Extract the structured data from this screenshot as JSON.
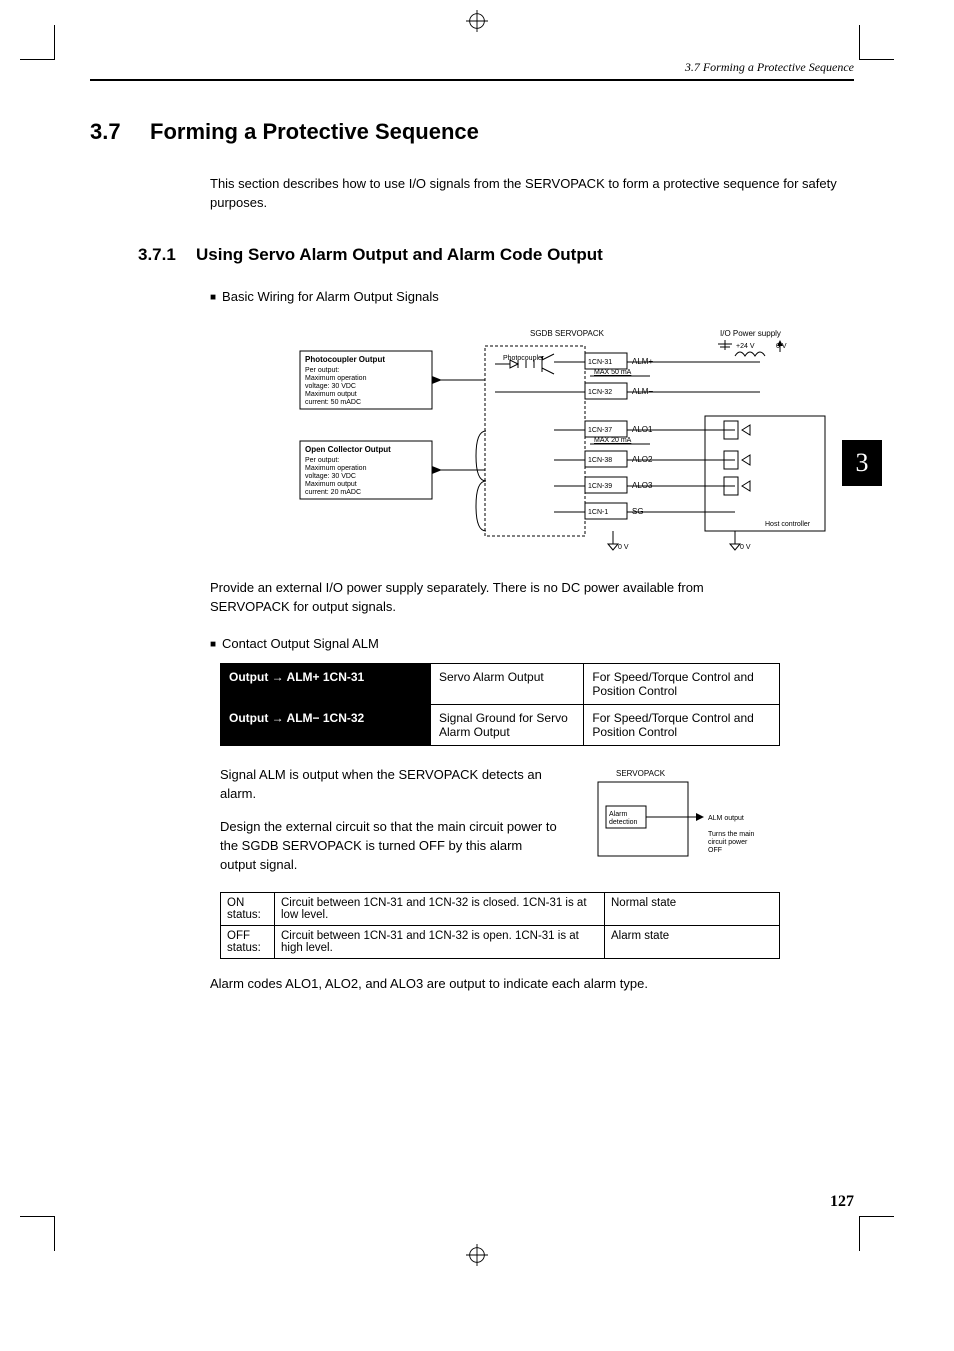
{
  "running_head": "3.7 Forming a Protective Sequence",
  "section": {
    "num": "3.7",
    "title": "Forming a Protective Sequence"
  },
  "intro": "This section describes how to use I/O signals from the SERVOPACK to form a protective sequence for safety purposes.",
  "subsection": {
    "num": "3.7.1",
    "title": "Using Servo Alarm Output and Alarm Code Output"
  },
  "bullet1": "Basic Wiring for Alarm Output Signals",
  "diagram": {
    "servopack_label": "SGDB SERVOPACK",
    "photocoupler": "Photocoupler",
    "io_power": "I/O  Power supply",
    "plus24": "+24 V",
    "zero_v": "0 V",
    "box1_title": "Photocoupler Output",
    "box1_lines": [
      "Per output:",
      "Maximum operation",
      "voltage: 30 VDC",
      "Maximum output",
      "current: 50 mADC"
    ],
    "box2_title": "Open Collector Output",
    "box2_lines": [
      "Per output:",
      "Maximum operation",
      "voltage: 30 VDC",
      "Maximum output",
      "current: 20 mADC"
    ],
    "rows": [
      {
        "pin": "1CN-31",
        "sig": "ALM+",
        "annot": "MAX 50 mA"
      },
      {
        "pin": "1CN-32",
        "sig": "ALM−",
        "annot": ""
      },
      {
        "pin": "1CN-37",
        "sig": "ALO1",
        "annot": "MAX 20 mA"
      },
      {
        "pin": "1CN-38",
        "sig": "ALO2",
        "annot": ""
      },
      {
        "pin": "1CN-39",
        "sig": "ALO3",
        "annot": ""
      },
      {
        "pin": "1CN-1",
        "sig": "SG",
        "annot": ""
      }
    ],
    "host": "Host controller"
  },
  "para1": "Provide an external I/O power supply separately. There is no DC power  available from SERVOPACK for output signals.",
  "bullet2": "Contact Output Signal ALM",
  "signal_table": {
    "r1": {
      "label": "Output → ALM+ 1CN-31",
      "mid": "Servo Alarm Output",
      "right": "For Speed/Torque Control and Position Control"
    },
    "r2": {
      "label": "Output → ALM− 1CN-32",
      "mid": "Signal Ground for Servo Alarm Output",
      "right": "For Speed/Torque Control and Position Control"
    }
  },
  "col_left_p1": "Signal ALM is output when the SERVOPACK detects an alarm.",
  "col_left_p2": "Design the external circuit so that the main circuit power to the SGDB SERVOPACK is turned OFF by this alarm output signal.",
  "mini": {
    "title": "SERVOPACK",
    "box": "Alarm detection",
    "out": "ALM output",
    "note": "Turns the main circuit power OFF"
  },
  "status_table": {
    "r1": {
      "c1": "ON status:",
      "c2": "Circuit between 1CN-31 and 1CN-32 is closed. 1CN-31 is at low level.",
      "c3": "Normal state"
    },
    "r2": {
      "c1": "OFF status:",
      "c2": "Circuit between 1CN-31 and 1CN-32 is open. 1CN-31 is at high level.",
      "c3": "Alarm state"
    }
  },
  "para2": "Alarm codes ALO1, ALO2, and ALO3 are output to indicate each alarm type.",
  "page_num": "127",
  "side_tab": "3"
}
